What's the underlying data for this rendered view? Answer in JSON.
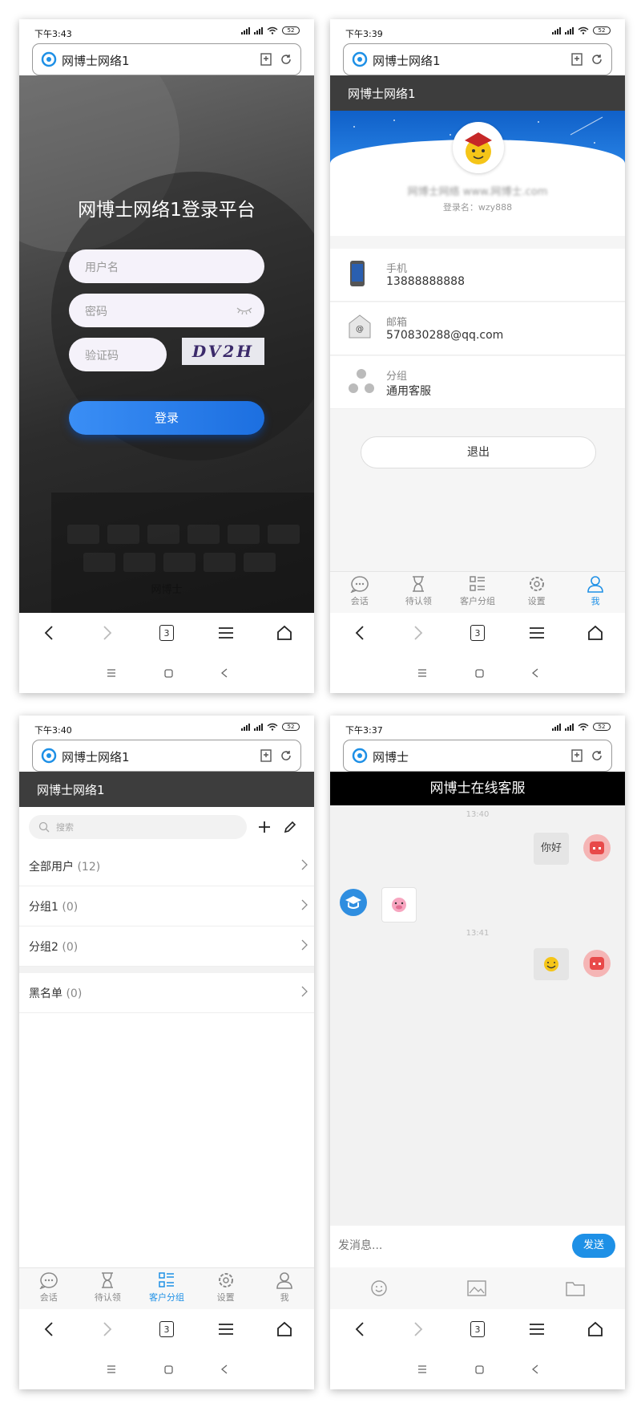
{
  "colors": {
    "accent": "#1e90e6",
    "dark_header": "#3d3d3d",
    "login_button": "#2a7ff0"
  },
  "phones": [
    {
      "time": "下午3:43",
      "url_title": "网博士网络1",
      "battery": "52"
    },
    {
      "time": "下午3:39",
      "url_title": "网博士网络1",
      "battery": "52"
    },
    {
      "time": "下午3:40",
      "url_title": "网博士网络1",
      "battery": "52"
    },
    {
      "time": "下午3:37",
      "url_title": "网博士",
      "battery": "52"
    }
  ],
  "browser_nav": {
    "tab_count": "3"
  },
  "login": {
    "title": "网博士网络1登录平台",
    "username_placeholder": "用户名",
    "password_placeholder": "密码",
    "captcha_placeholder": "验证码",
    "captcha_text": "DV2H",
    "login_button": "登录",
    "footer": "网博士"
  },
  "profile": {
    "header": "网博士网络1",
    "name_blurred": "网博士网络 www.网博士.com",
    "login_name": "登录名：wzy888",
    "rows": [
      {
        "label": "手机",
        "value": "13888888888",
        "icon": "phone-icon"
      },
      {
        "label": "邮箱",
        "value": "570830288@qq.com",
        "icon": "mail-icon"
      },
      {
        "label": "分组",
        "value": "通用客服",
        "icon": "group-icon"
      }
    ],
    "logout": "退出"
  },
  "tabbar": [
    {
      "label": "会话",
      "icon": "chat-icon"
    },
    {
      "label": "待认领",
      "icon": "hourglass-icon"
    },
    {
      "label": "客户分组",
      "icon": "list-icon"
    },
    {
      "label": "设置",
      "icon": "gear-icon"
    },
    {
      "label": "我",
      "icon": "user-icon"
    }
  ],
  "groups": {
    "header": "网博士网络1",
    "search_placeholder": "搜索",
    "rows": [
      {
        "name": "全部用户",
        "count": "(12)"
      },
      {
        "name": "分组1",
        "count": "(0)"
      },
      {
        "name": "分组2",
        "count": "(0)"
      },
      {
        "name": "黑名单",
        "count": "(0)"
      }
    ]
  },
  "chat": {
    "title": "网博士在线客服",
    "ts1": "13:40",
    "msg1": "你好",
    "ts2": "13:41",
    "input_placeholder": "发消息...",
    "send": "发送"
  }
}
